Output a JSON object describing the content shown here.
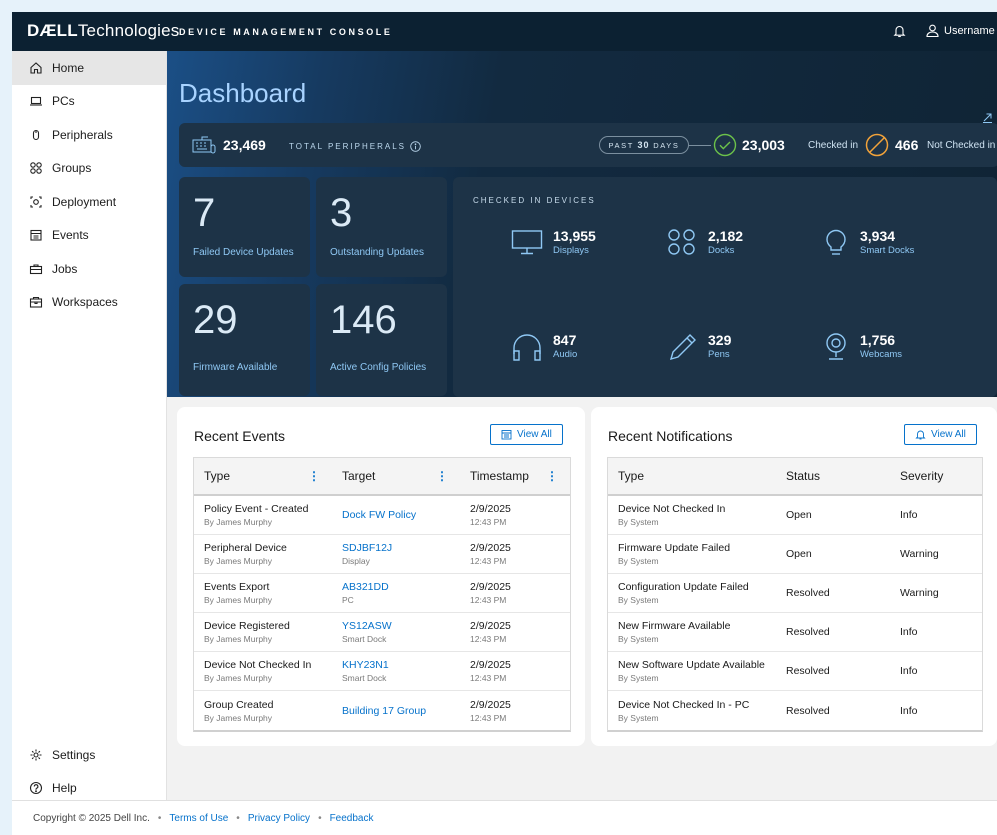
{
  "header": {
    "logo_bold": "DÆLL",
    "logo_rest": "Technologies",
    "app_title": "DEVICE MANAGEMENT CONSOLE",
    "username": "Username"
  },
  "sidebar": {
    "items": [
      {
        "label": "Home",
        "icon": "home-icon"
      },
      {
        "label": "PCs",
        "icon": "laptop-icon"
      },
      {
        "label": "Peripherals",
        "icon": "mouse-icon"
      },
      {
        "label": "Groups",
        "icon": "groups-icon"
      },
      {
        "label": "Deployment",
        "icon": "deployment-icon"
      },
      {
        "label": "Events",
        "icon": "calendar-icon"
      },
      {
        "label": "Jobs",
        "icon": "briefcase-icon"
      },
      {
        "label": "Workspaces",
        "icon": "workspace-icon"
      }
    ],
    "bottom": [
      {
        "label": "Settings",
        "icon": "gear-icon"
      },
      {
        "label": "Help",
        "icon": "help-icon"
      }
    ]
  },
  "dashboard": {
    "title": "Dashboard",
    "total_peripherals": "23,469",
    "total_label": "TOTAL PERIPHERALS",
    "period_prefix": "PAST",
    "period_value": "30",
    "period_suffix": "DAYS",
    "checked_in_count": "23,003",
    "checked_in_label": "Checked in",
    "not_checked_in_count": "466",
    "not_checked_in_label": "Not Checked in",
    "tiles": [
      {
        "value": "7",
        "label": "Failed Device Updates"
      },
      {
        "value": "3",
        "label": "Outstanding Updates"
      },
      {
        "value": "29",
        "label": "Firmware Available"
      },
      {
        "value": "146",
        "label": "Active Config Policies"
      }
    ],
    "devices_heading": "CHECKED IN DEVICES",
    "devices": [
      {
        "count": "13,955",
        "label": "Displays",
        "icon": "monitor-icon"
      },
      {
        "count": "2,182",
        "label": "Docks",
        "icon": "dock-icon"
      },
      {
        "count": "3,934",
        "label": "Smart Docks",
        "icon": "lightbulb-icon"
      },
      {
        "count": "847",
        "label": "Audio",
        "icon": "headphones-icon"
      },
      {
        "count": "329",
        "label": "Pens",
        "icon": "pen-icon"
      },
      {
        "count": "1,756",
        "label": "Webcams",
        "icon": "webcam-icon"
      }
    ]
  },
  "recent_events": {
    "title": "Recent Events",
    "view_all": "View All",
    "columns": [
      "Type",
      "Target",
      "Timestamp"
    ],
    "rows": [
      {
        "type": "Policy Event - Created",
        "by": "By James Murphy",
        "target": "Dock FW Policy",
        "target_sub": "",
        "date": "2/9/2025",
        "time": "12:43 PM"
      },
      {
        "type": "Peripheral Device",
        "by": "By James Murphy",
        "target": "SDJBF12J",
        "target_sub": "Display",
        "date": "2/9/2025",
        "time": "12:43 PM"
      },
      {
        "type": "Events Export",
        "by": "By James Murphy",
        "target": "AB321DD",
        "target_sub": "PC",
        "date": "2/9/2025",
        "time": "12:43 PM"
      },
      {
        "type": "Device Registered",
        "by": "By James Murphy",
        "target": "YS12ASW",
        "target_sub": "Smart Dock",
        "date": "2/9/2025",
        "time": "12:43 PM"
      },
      {
        "type": "Device Not Checked In",
        "by": "By James Murphy",
        "target": "KHY23N1",
        "target_sub": "Smart Dock",
        "date": "2/9/2025",
        "time": "12:43 PM"
      },
      {
        "type": "Group Created",
        "by": "By James Murphy",
        "target": "Building 17 Group",
        "target_sub": "",
        "date": "2/9/2025",
        "time": "12:43 PM"
      }
    ]
  },
  "recent_notifications": {
    "title": "Recent Notifications",
    "view_all": "View All",
    "columns": [
      "Type",
      "Status",
      "Severity"
    ],
    "rows": [
      {
        "type": "Device Not Checked In",
        "by": "By System",
        "status": "Open",
        "severity": "Info"
      },
      {
        "type": "Firmware Update Failed",
        "by": "By System",
        "status": "Open",
        "severity": "Warning"
      },
      {
        "type": "Configuration Update Failed",
        "by": "By System",
        "status": "Resolved",
        "severity": "Warning"
      },
      {
        "type": "New Firmware Available",
        "by": "By System",
        "status": "Resolved",
        "severity": "Info"
      },
      {
        "type": "New Software Update Available",
        "by": "By System",
        "status": "Resolved",
        "severity": "Info"
      },
      {
        "type": "Device Not Checked In - PC",
        "by": "By System",
        "status": "Resolved",
        "severity": "Info"
      }
    ]
  },
  "footer": {
    "copyright": "Copyright © 2025 Dell Inc.",
    "links": [
      "Terms of Use",
      "Privacy Policy",
      "Feedback"
    ]
  },
  "colors": {
    "accent": "#0672cb",
    "header_bg": "#0c2132",
    "panel_bg": "#1d3347",
    "checked_green": "#6cc24a",
    "not_checked_orange": "#f2a33a"
  }
}
